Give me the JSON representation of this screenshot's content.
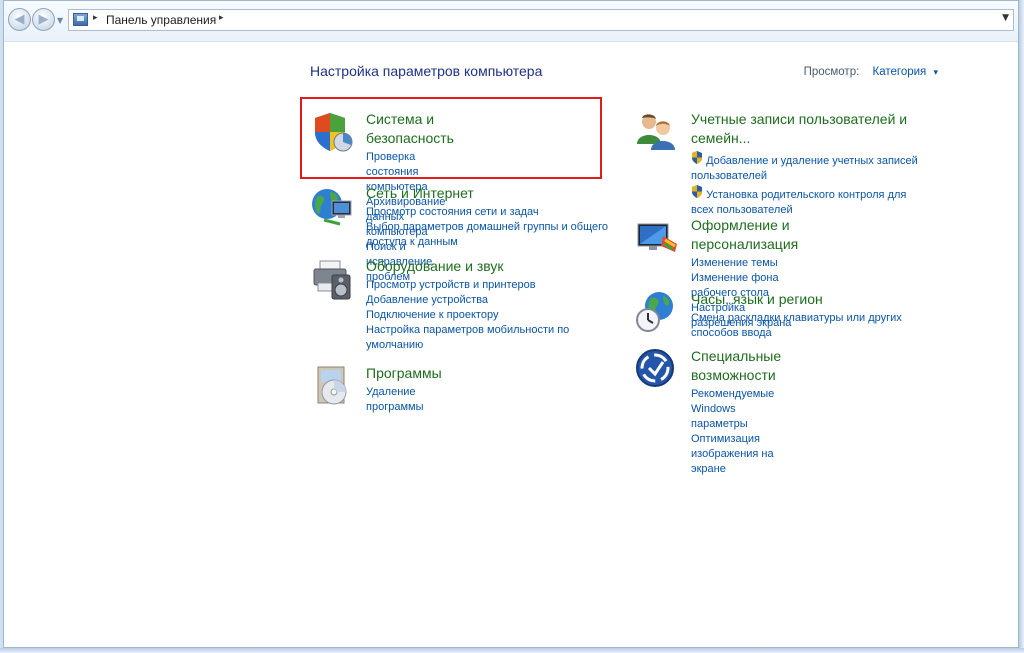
{
  "address_bar": {
    "breadcrumb": "Панель управления",
    "separator": "▸"
  },
  "page": {
    "title": "Настройка параметров компьютера",
    "view_by_label": "Просмотр:",
    "view_by_value": "Категория",
    "view_by_arrow": "▾"
  },
  "left_categories": [
    {
      "title": "Система и безопасность",
      "icon": "shield-icon",
      "links": [
        "Проверка состояния компьютера",
        "Архивирование данных компьютера",
        "Поиск и исправление проблем"
      ]
    },
    {
      "title": "Сеть и Интернет",
      "icon": "network-globe-icon",
      "links": [
        "Просмотр состояния сети и задач",
        "Выбор параметров домашней группы и общего доступа к данным"
      ]
    },
    {
      "title": "Оборудование и звук",
      "icon": "printer-speaker-icon",
      "links": [
        "Просмотр устройств и принтеров",
        "Добавление устройства",
        "Подключение к проектору",
        "Настройка параметров мобильности по умолчанию"
      ]
    },
    {
      "title": "Программы",
      "icon": "programs-disc-icon",
      "links": [
        "Удаление программы"
      ]
    }
  ],
  "right_categories": [
    {
      "title": "Учетные записи пользователей и семейн...",
      "icon": "users-icon",
      "links": [
        "Добавление и удаление учетных записей пользователей",
        "Установка родительского контроля для всех пользователей"
      ]
    },
    {
      "title": "Оформление и персонализация",
      "icon": "monitor-personalization-icon",
      "links": [
        "Изменение темы",
        "Изменение фона рабочего стола",
        "Настройка разрешения экрана"
      ]
    },
    {
      "title": "Часы, язык и регион",
      "icon": "clock-globe-icon",
      "links": [
        "Смена раскладки клавиатуры или других способов ввода"
      ]
    },
    {
      "title": "Специальные возможности",
      "icon": "accessibility-icon",
      "links": [
        "Рекомендуемые Windows параметры",
        "Оптимизация изображения на экране"
      ]
    }
  ],
  "colors": {
    "category_title": "#1e6d1e",
    "link": "#0b55a6",
    "page_title": "#1e3287",
    "highlight_border": "#e01b1b"
  }
}
